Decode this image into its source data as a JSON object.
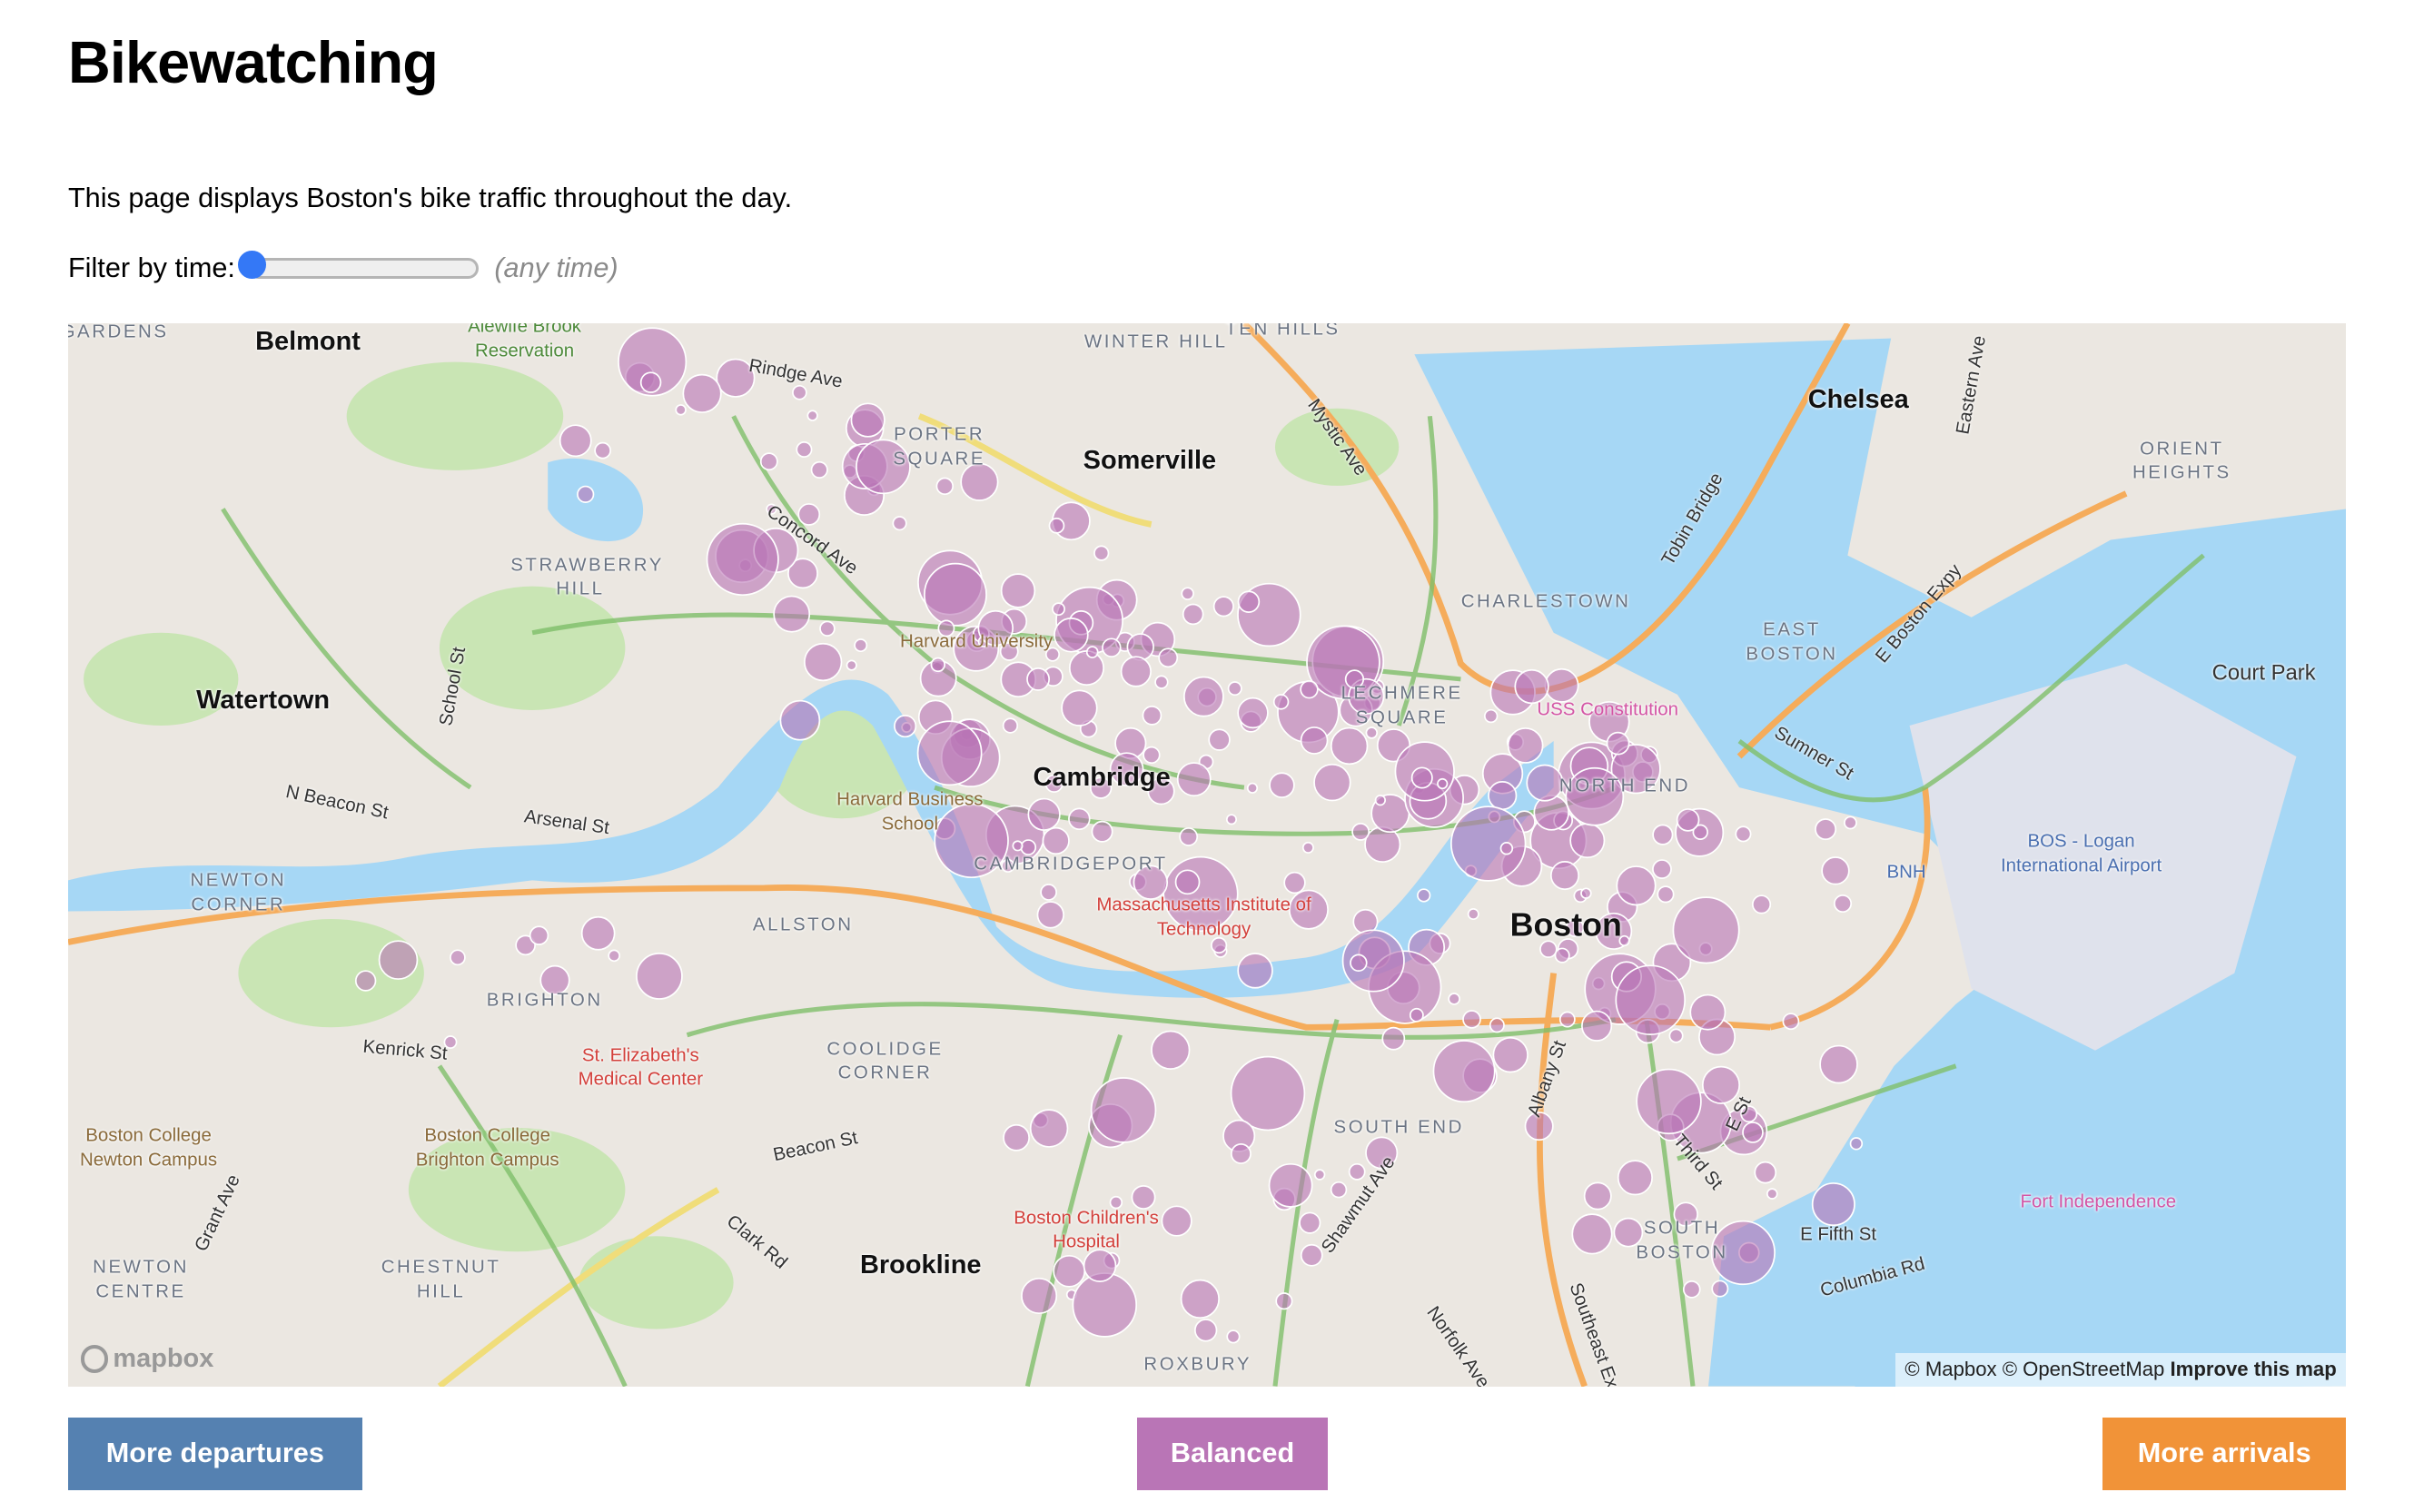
{
  "page": {
    "title": "Bikewatching",
    "intro": "This page displays Boston's bike traffic throughout the day.",
    "filter_label": "Filter by time:",
    "time_value": "(any time)",
    "slider_value": 0
  },
  "map": {
    "cities": [
      "Belmont",
      "Watertown",
      "Somerville",
      "Chelsea",
      "Cambridge",
      "Boston",
      "Brookline",
      "Court Park"
    ],
    "neighborhoods": [
      "GARDENS",
      "WINTER HILL",
      "TEN HILLS",
      "PORTER SQUARE",
      "STRAWBERRY HILL",
      "CHARLESTOWN",
      "EAST BOSTON",
      "ORIENT HEIGHTS",
      "LECHMERE SQUARE",
      "NORTH END",
      "CAMBRIDGEPORT",
      "ALLSTON",
      "BRIGHTON",
      "NEWTON CORNER",
      "COOLIDGE CORNER",
      "SOUTH END",
      "SOUTH BOSTON",
      "NEWTON CENTRE",
      "CHESTNUT HILL",
      "ROXBURY"
    ],
    "pois": [
      "Alewife Brook Reservation",
      "Harvard University",
      "Harvard Business School",
      "Massachusetts Institute of Technology",
      "St. Elizabeth's Medical Center",
      "Boston Children's Hospital",
      "USS Constitution",
      "Fort Independence",
      "BOS - Logan International Airport",
      "BNH",
      "Boston College Newton Campus",
      "Boston College Brighton Campus"
    ],
    "streets": [
      "Rindge Ave",
      "Concord Ave",
      "N Beacon St",
      "Arsenal St",
      "Kenrick St",
      "Beacon St",
      "Clark Rd",
      "Mystic Ave",
      "Tobin Bridge",
      "E Boston Expy",
      "Sumner St",
      "Albany St",
      "Shawmut Ave",
      "Norfolk Ave",
      "Southeast Expy",
      "E Fifth St",
      "Columbia Rd",
      "E St",
      "Third St",
      "Grant Ave",
      "School St",
      "Eastern Ave"
    ],
    "attribution": "© Mapbox © OpenStreetMap",
    "improve_link": "Improve this map",
    "logo": "mapbox",
    "station_color": "#b975b6"
  },
  "legend": {
    "departures": {
      "label": "More departures",
      "color": "#5581b1"
    },
    "balanced": {
      "label": "Balanced",
      "color": "#b975b6"
    },
    "arrivals": {
      "label": "More arrivals",
      "color": "#f19338"
    }
  }
}
